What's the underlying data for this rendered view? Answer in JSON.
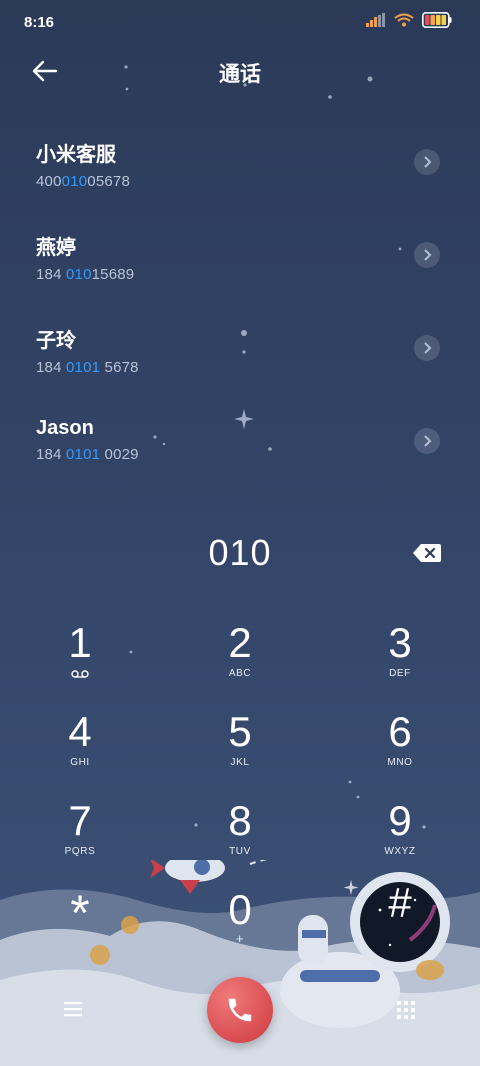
{
  "status_bar": {
    "time": "8:16"
  },
  "header": {
    "title": "通话"
  },
  "contacts": [
    {
      "name": "小米客服",
      "number_pre": "400",
      "number_hl": "010",
      "number_post": "05678"
    },
    {
      "name": "燕婷",
      "number_pre": "184 ",
      "number_hl": "010",
      "number_post": "15689"
    },
    {
      "name": "子玲",
      "number_pre": "184 ",
      "number_hl": "0101",
      "number_post": " 5678"
    },
    {
      "name": "Jason",
      "number_pre": "184 ",
      "number_hl": "0101",
      "number_post": " 0029"
    }
  ],
  "dial": {
    "input": "010"
  },
  "keypad": [
    {
      "digit": "1",
      "letters": ""
    },
    {
      "digit": "2",
      "letters": "ABC"
    },
    {
      "digit": "3",
      "letters": "DEF"
    },
    {
      "digit": "4",
      "letters": "GHI"
    },
    {
      "digit": "5",
      "letters": "JKL"
    },
    {
      "digit": "6",
      "letters": "MNO"
    },
    {
      "digit": "7",
      "letters": "PQRS"
    },
    {
      "digit": "8",
      "letters": "TUV"
    },
    {
      "digit": "9",
      "letters": "WXYZ"
    },
    {
      "digit": "*",
      "letters": ""
    },
    {
      "digit": "0",
      "letters": "+"
    },
    {
      "digit": "#",
      "letters": ""
    }
  ],
  "icons": {
    "back": "back-arrow-icon",
    "voicemail": "voicemail-icon",
    "backspace": "backspace-icon",
    "menu": "menu-icon",
    "call": "phone-icon",
    "dialpad": "dialpad-icon"
  },
  "colors": {
    "background_top": "#2c3a58",
    "highlight": "#2f9bff",
    "call_button": "#d84c50"
  }
}
